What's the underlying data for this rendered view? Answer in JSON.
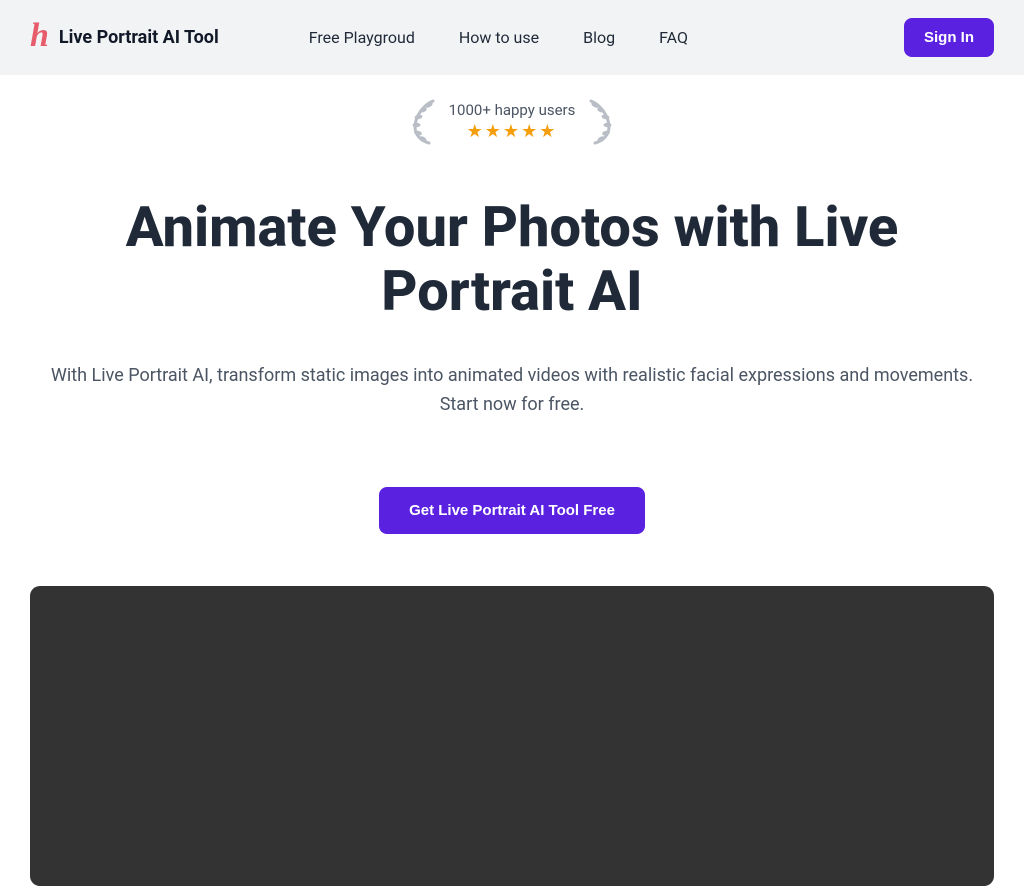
{
  "header": {
    "brand": "Live Portrait AI Tool",
    "nav": {
      "playground": "Free Playgroud",
      "howto": "How to use",
      "blog": "Blog",
      "faq": "FAQ"
    },
    "signin": "Sign In"
  },
  "hero": {
    "badge_text": "1000+ happy users",
    "stars": "★★★★★",
    "title": "Animate Your Photos with Live Portrait AI",
    "subtitle": "With Live Portrait AI, transform static images into animated videos with realistic facial expressions and movements. Start now for free.",
    "cta": "Get Live Portrait AI Tool Free"
  }
}
